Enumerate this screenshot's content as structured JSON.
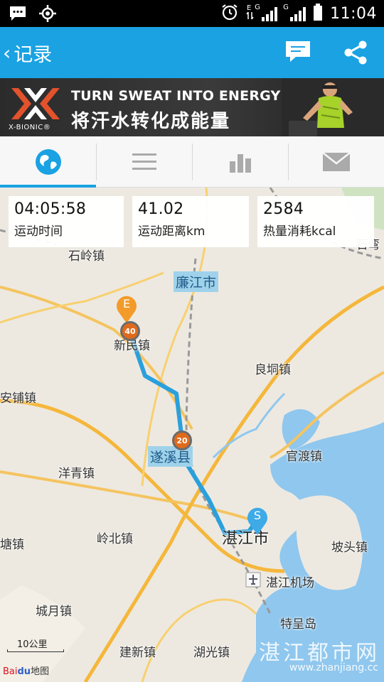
{
  "status_bar": {
    "time": "11:04",
    "network_1": "G",
    "network_2": "G",
    "left_icons": [
      "message-icon",
      "gps-icon"
    ],
    "right_icons": [
      "alarm-icon",
      "edge-icon",
      "signal-icon",
      "signal-icon",
      "battery-icon"
    ]
  },
  "app_bar": {
    "title": "记录",
    "back_icon": "chevron-left-icon",
    "actions": [
      "comment-icon",
      "share-icon"
    ],
    "color": "#1aa2e3"
  },
  "ad": {
    "brand": "X-BIONIC®",
    "line1": "TURN SWEAT INTO ENERGY",
    "line2": "将汗水转化成能量"
  },
  "tabs": [
    {
      "icon": "globe-icon",
      "active": true
    },
    {
      "icon": "list-icon",
      "active": false
    },
    {
      "icon": "bar-chart-icon",
      "active": false
    },
    {
      "icon": "mail-icon",
      "active": false
    }
  ],
  "stats": {
    "duration": {
      "value": "04:05:58",
      "label": "运动时间"
    },
    "distance": {
      "value": "41.02",
      "label": "运动距离km"
    },
    "calories": {
      "value": "2584",
      "label": "热量消耗kcal"
    }
  },
  "map": {
    "places": {
      "shiling": "石岭镇",
      "lianjiang": "廉江市",
      "xinmin": "新民镇",
      "liangdong": "良垌镇",
      "anpu": "安铺镇",
      "suixi": "遂溪县",
      "yangqing": "洋青镇",
      "guandu": "官渡镇",
      "tang": "塘镇",
      "lingbei": "岭北镇",
      "zhanjiang": "湛江市",
      "potou": "坡头镇",
      "airport": "湛江机场",
      "chengyue": "城月镇",
      "techeng": "特呈岛",
      "jianxin": "建新镇",
      "huguang": "湖光镇",
      "shiwan": "石弯"
    },
    "km_markers": [
      "40",
      "20"
    ],
    "start_label": "S",
    "end_label": "E",
    "scale": "10公里",
    "provider_a": "Bai",
    "provider_b": "du",
    "provider_c": "地图",
    "watermark": "湛江都市网",
    "watermark_url": "www.zhanjiang.cc"
  }
}
